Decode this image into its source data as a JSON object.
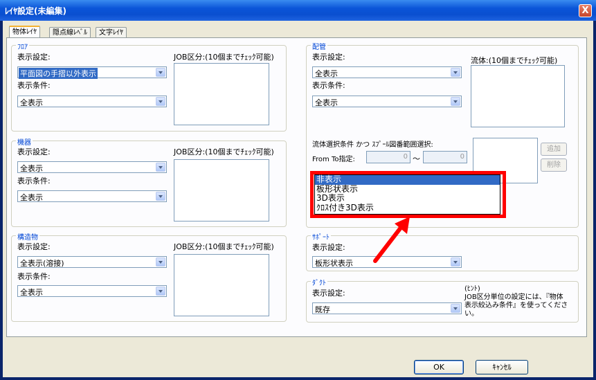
{
  "window": {
    "title": "ﾚｲﾔ設定(未編集)",
    "close_label": "X"
  },
  "tabs": [
    "物体ﾚｲﾔ",
    "隠点線ﾚﾍﾞﾙ",
    "文字ﾚｲﾔ"
  ],
  "flow": {
    "legend": "ﾌﾛｱ",
    "display_setting_label": "表示設定:",
    "display_setting_value": "平面図の手摺以外表示",
    "display_condition_label": "表示条件:",
    "display_condition_value": "全表示",
    "job_label": "JOB区分:(10個までﾁｪｯｸ可能)"
  },
  "equipment": {
    "legend": "機器",
    "display_setting_label": "表示設定:",
    "display_setting_value": "全表示",
    "display_condition_label": "表示条件:",
    "display_condition_value": "全表示",
    "job_label": "JOB区分:(10個までﾁｪｯｸ可能)"
  },
  "structure": {
    "legend": "構造物",
    "display_setting_label": "表示設定:",
    "display_setting_value": "全表示(溶接)",
    "display_condition_label": "表示条件:",
    "display_condition_value": "全表示",
    "job_label": "JOB区分:(10個までﾁｪｯｸ可能)"
  },
  "piping": {
    "legend": "配管",
    "display_setting_label": "表示設定:",
    "display_setting_value": "全表示",
    "display_condition_label": "表示条件:",
    "display_condition_value": "全表示",
    "fluid_label": "流体:(10個までﾁｪｯｸ可能)",
    "selection_label": "流体選択条件 かつ ｽﾌﾟｰﾙ図番範囲選択:",
    "from_to_label": "From To指定:",
    "from_value": "0",
    "tilde": "～",
    "to_value": "0",
    "add_label": "追加",
    "delete_label": "削除"
  },
  "dropdown_options": [
    "非表示",
    "板形状表示",
    "3D表示",
    "ｸﾛｽ付き3D表示"
  ],
  "support": {
    "legend": "ｻﾎﾟｰﾄ",
    "display_setting_label": "表示設定:",
    "display_setting_value": "板形状表示"
  },
  "duct": {
    "legend": "ﾀﾞｸﾄ",
    "display_setting_label": "表示設定:",
    "display_setting_value": "既存"
  },
  "hint": {
    "title": "(ﾋﾝﾄ)",
    "text_line1": "JOB区分単位の設定には、『物体",
    "text_line2": "表示絞込み条件』を使ってください。"
  },
  "buttons": {
    "ok": "OK",
    "cancel": "ｷｬﾝｾﾙ"
  },
  "colors": {
    "annotation": "#ff0000",
    "selection": "#316ac5",
    "legend_text": "#0046d5"
  }
}
